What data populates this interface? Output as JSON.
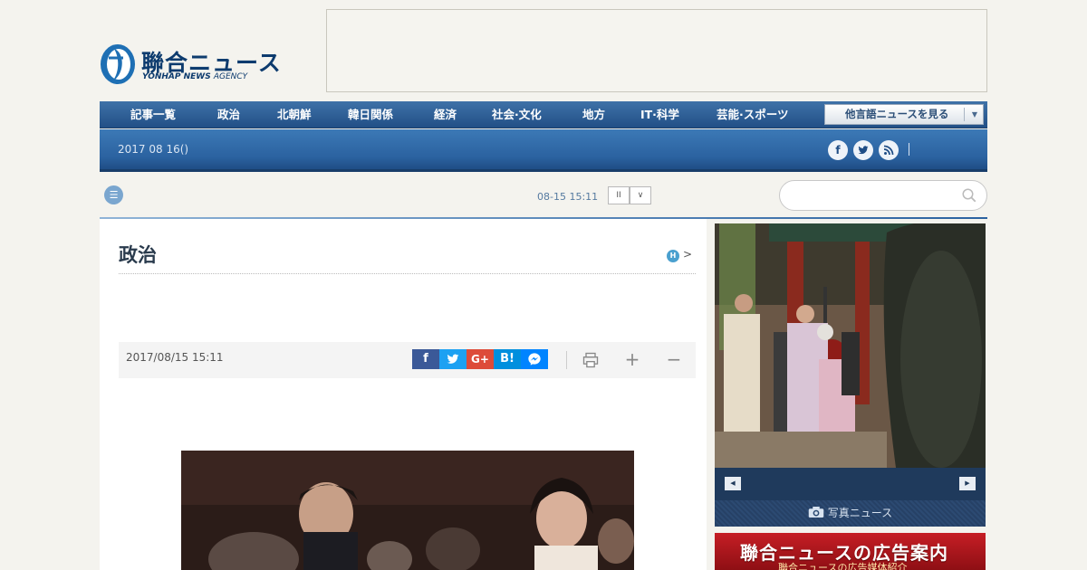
{
  "header": {
    "logo_jp": "聯合ニュース",
    "logo_en_bold": "YONHAP NEWS",
    "logo_en_light": "AGENCY"
  },
  "nav": {
    "items": [
      {
        "label": "記事一覧"
      },
      {
        "label": "政治"
      },
      {
        "label": "北朝鮮"
      },
      {
        "label": "韓日関係"
      },
      {
        "label": "経済"
      },
      {
        "label": "社会·文化"
      },
      {
        "label": "地方"
      },
      {
        "label": "IT·科学"
      },
      {
        "label": "芸能·スポーツ"
      }
    ],
    "language_select": "他言語ニュースを見る"
  },
  "subbar": {
    "date": "2017 08 16()",
    "social": [
      "facebook-icon",
      "twitter-icon",
      "rss-icon"
    ]
  },
  "ticker": {
    "time": "08-15 15:11",
    "pause_label": "II",
    "next_label": "∨"
  },
  "search": {
    "placeholder": ""
  },
  "article": {
    "section": "政治",
    "badge": "H",
    "arrow": ">",
    "datetime": "2017/08/15 15:11",
    "share": [
      {
        "label": "f",
        "color": "#3b5998",
        "name": "facebook-share-button"
      },
      {
        "label": "🐦",
        "color": "#1da1f2",
        "name": "twitter-share-button"
      },
      {
        "label": "G+",
        "color": "#dd4b39",
        "name": "googleplus-share-button"
      },
      {
        "label": "B!",
        "color": "#008fde",
        "name": "hatena-share-button"
      },
      {
        "label": "m",
        "color": "#0084ff",
        "name": "messenger-share-button"
      }
    ],
    "tools": {
      "print": "🖶",
      "zoom_in": "+",
      "zoom_out": "−"
    }
  },
  "sidebar": {
    "prev": "◀",
    "next": "▶",
    "photo_news": "写真ニュース",
    "ad_title": "聯合ニュースの広告案内",
    "ad_subtitle": "聯合ニュースの広告媒体紹介"
  }
}
